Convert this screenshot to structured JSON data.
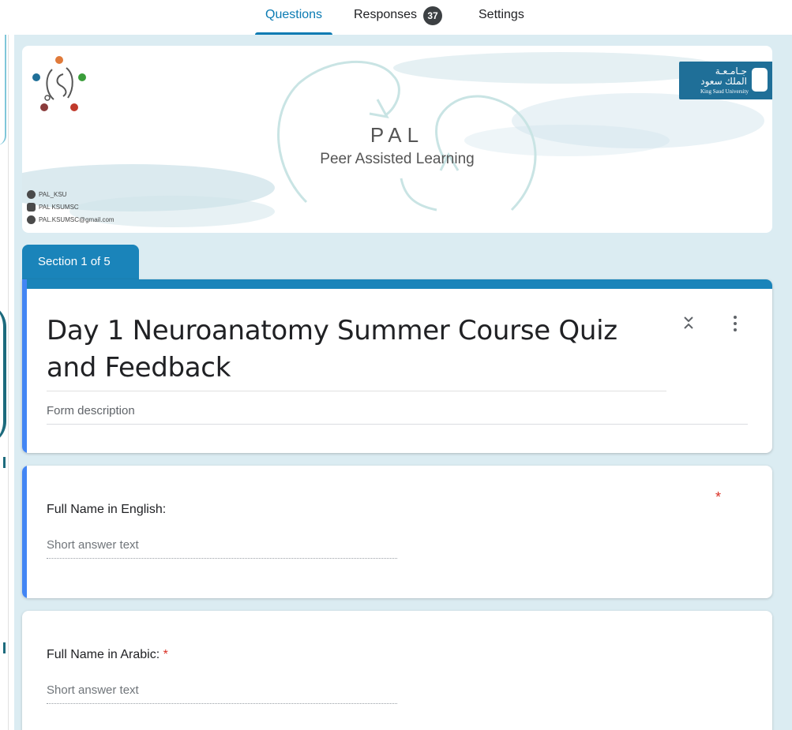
{
  "tabs": [
    {
      "label": "Questions",
      "active": true
    },
    {
      "label": "Responses",
      "badge": "37",
      "active": false
    },
    {
      "label": "Settings",
      "active": false
    }
  ],
  "header": {
    "title": "PAL",
    "subtitle": "Peer Assisted Learning",
    "university_ar_line1": "جـامـعـة",
    "university_ar_line2": "الملك سعود",
    "university_en": "King Saud University",
    "socials": [
      {
        "icon": "twitter-icon",
        "text": "PAL_KSU"
      },
      {
        "icon": "youtube-icon",
        "text": "PAL KSUMSC"
      },
      {
        "icon": "email-icon",
        "text": "PAL.KSUMSC@gmail.com"
      }
    ]
  },
  "section": {
    "label": "Section 1 of 5"
  },
  "form": {
    "title": "Day 1 Neuroanatomy Summer Course Quiz and Feedback",
    "description_placeholder": "Form description"
  },
  "questions": [
    {
      "label": "Full Name in English:",
      "required_mark": "*",
      "answer_placeholder": "Short answer text"
    },
    {
      "label": "Full Name in Arabic:",
      "required_mark": "*",
      "answer_placeholder": "Short answer text"
    }
  ],
  "colors": {
    "accent": "#0b7bb3",
    "section": "#1a84ba",
    "focus_bar": "#4285f4",
    "required": "#d93025",
    "canvas": "#dbecf2"
  }
}
